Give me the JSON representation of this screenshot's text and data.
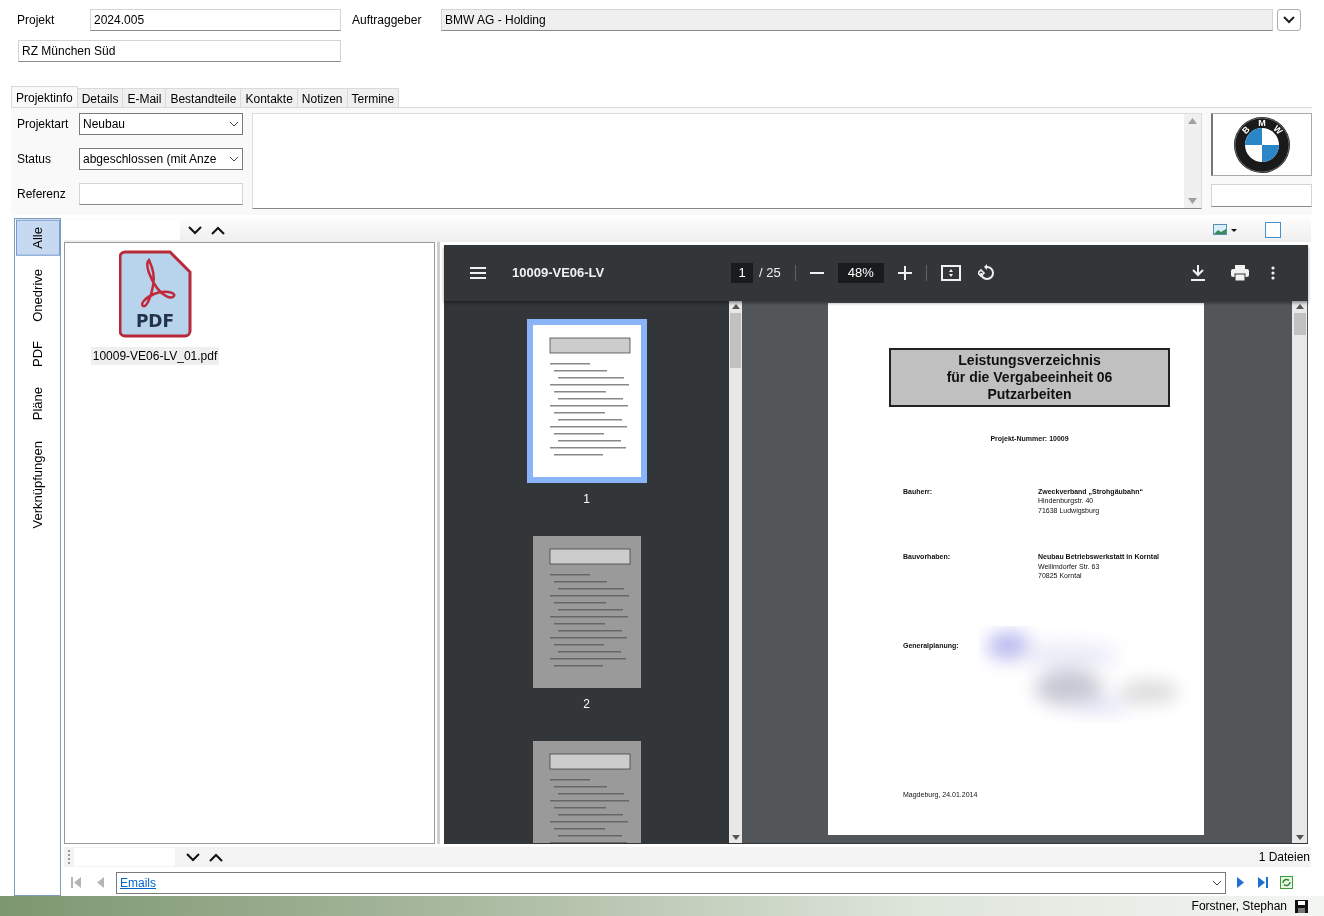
{
  "header": {
    "projekt_label": "Projekt",
    "projekt_value": "2024.005",
    "auftraggeber_label": "Auftraggeber",
    "auftraggeber_value": "BMW AG - Holding",
    "name_value": "RZ München Süd"
  },
  "tabs": [
    {
      "label": "Projektinfo",
      "selected": true
    },
    {
      "label": "Details",
      "selected": false
    },
    {
      "label": "E-Mail",
      "selected": false
    },
    {
      "label": "Bestandteile",
      "selected": false
    },
    {
      "label": "Kontakte",
      "selected": false
    },
    {
      "label": "Notizen",
      "selected": false
    },
    {
      "label": "Termine",
      "selected": false
    }
  ],
  "projektinfo": {
    "fields": [
      {
        "label": "Projektart",
        "value": "Neubau",
        "kind": "combo"
      },
      {
        "label": "Status",
        "value": "abgeschlossen  (mit Anze",
        "kind": "combo"
      },
      {
        "label": "Referenz",
        "kind": "text"
      }
    ],
    "logo_letters": [
      "B",
      "M",
      "W"
    ]
  },
  "side_tabs": [
    {
      "label": "Alle",
      "selected": true
    },
    {
      "label": "Onedrive",
      "selected": false
    },
    {
      "label": "PDF",
      "selected": false
    },
    {
      "label": "Pläne",
      "selected": false
    },
    {
      "label": "Verknüpfungen",
      "selected": false
    }
  ],
  "files": [
    {
      "name": "10009-VE06-LV_01.pdf",
      "icon_label": "PDF"
    }
  ],
  "pdf_viewer": {
    "title": "10009-VE06-LV",
    "page": "1",
    "page_count": "/ 25",
    "zoom": "48%",
    "thumbnails": [
      {
        "label": "1",
        "selected": true
      },
      {
        "label": "2",
        "selected": false
      },
      {
        "selected": false
      }
    ],
    "document": {
      "title_lines": [
        "Leistungsverzeichnis",
        "für die Vergabeeinheit 06",
        "Putzarbeiten"
      ],
      "project_number": "Projekt-Nummer: 10009",
      "entries": [
        {
          "label": "Bauherr:",
          "kind": "text",
          "lines": [
            "Zweckverband „Strohgäubahn“",
            "Hindenburgstr. 40",
            "71638 Ludwigsburg"
          ]
        },
        {
          "label": "Bauvorhaben:",
          "kind": "text",
          "lines": [
            "Neubau Betriebswerkstatt in Korntal",
            "Weilimdorfer Str. 63",
            "70825 Korntal"
          ]
        },
        {
          "label": "Generalplanung:",
          "kind": "blurred"
        }
      ],
      "footer": "Magdeburg, 24.01.2014"
    }
  },
  "file_count": "1 Dateien",
  "navigator": {
    "value": "Emails"
  },
  "status_bar": {
    "user": "Forstner, Stephan"
  }
}
